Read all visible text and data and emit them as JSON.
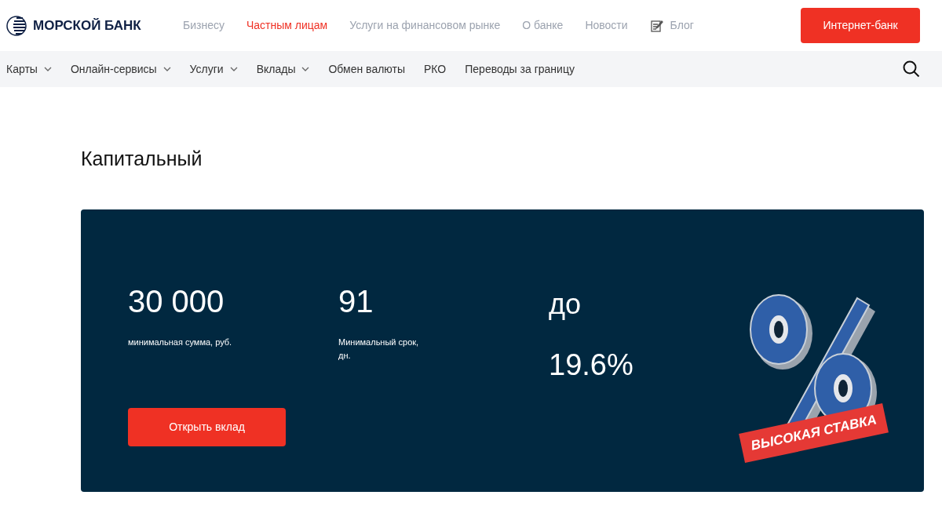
{
  "logo": {
    "name": "МОРСКОЙ БАНК"
  },
  "top_nav": [
    {
      "label": "Бизнесу",
      "selected": false,
      "kind": "link"
    },
    {
      "label": "Частным лицам",
      "selected": true,
      "kind": "link"
    },
    {
      "label": "Услуги на финансовом рынке",
      "selected": false,
      "kind": "link"
    },
    {
      "label": "О банке",
      "selected": false,
      "kind": "link"
    },
    {
      "label": "Новости",
      "selected": false,
      "kind": "link"
    },
    {
      "label": "Блог",
      "selected": false,
      "kind": "blog"
    }
  ],
  "login_button": "Интернет-банк",
  "sub_nav": [
    {
      "label": "Карты",
      "dropdown": true
    },
    {
      "label": "Онлайн-сервисы",
      "dropdown": true
    },
    {
      "label": "Услуги",
      "dropdown": true
    },
    {
      "label": "Вклады",
      "dropdown": true
    },
    {
      "label": "Обмен валюты",
      "dropdown": false
    },
    {
      "label": "РКО",
      "dropdown": false
    },
    {
      "label": "Переводы за границу",
      "dropdown": false
    }
  ],
  "page_title": "Капитальный",
  "deposit": {
    "stats": [
      {
        "value": "30 000",
        "caption": "минимальная сумма, руб."
      },
      {
        "value": "91",
        "caption": "Минимальный срок, дн."
      }
    ],
    "rate_prefix": "до",
    "rate": "19.6%",
    "button": "Открыть вклад",
    "badge": "ВЫСОКАЯ СТАВКА"
  }
}
